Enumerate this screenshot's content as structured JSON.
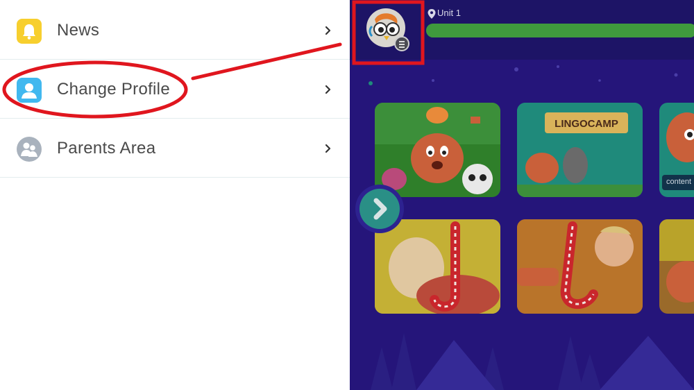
{
  "menu": {
    "items": [
      {
        "label": "News",
        "icon": "bell-icon"
      },
      {
        "label": "Change Profile",
        "icon": "profile-icon"
      },
      {
        "label": "Parents Area",
        "icon": "parents-icon"
      }
    ]
  },
  "app": {
    "unit_label": "Unit 1",
    "unit_progress": 1.0,
    "content_chip": "content"
  },
  "colors": {
    "annotation_red": "#e0161e",
    "news_icon_bg": "#f7cf2e",
    "profile_icon_bg": "#41b8ef",
    "app_background": "#25157a",
    "progress_green": "#3f9a3d"
  }
}
